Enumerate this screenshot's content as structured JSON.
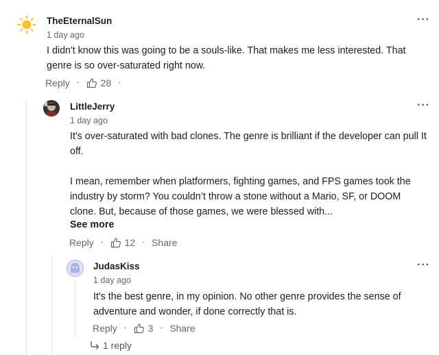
{
  "comments": [
    {
      "username": "TheEternalSun",
      "time": "1 day ago",
      "lines": [
        "I didn't know this was going to be a souls-like. That makes me less interested. That",
        "genre is so over-saturated right now."
      ],
      "actions": {
        "reply": "Reply",
        "likes": "28"
      },
      "avatar_icon": "sun-icon",
      "avatar_color": "#f6c12b"
    },
    {
      "username": "LittleJerry",
      "time": "1 day ago",
      "lines": [
        "It's over-saturated with bad clones. The genre is brilliant if the developer can pull It",
        "off.",
        "",
        "I mean, remember when platformers, fighting games, and FPS games took the",
        "industry by storm? You couldn’t throw a stone without a Mario, SF, or DOOM",
        "clone. But, because of those games, we were blessed with..."
      ],
      "see_more": "See more",
      "actions": {
        "reply": "Reply",
        "likes": "12",
        "share": "Share"
      },
      "avatar_icon": "photo-avatar-icon"
    },
    {
      "username": "JudasKiss",
      "time": "1 day ago",
      "lines": [
        "It's the best genre, in my opinion. No other genre provides the sense of",
        "adventure and wonder, if done correctly that is."
      ],
      "actions": {
        "reply": "Reply",
        "likes": "3",
        "share": "Share"
      },
      "replies_link": "1 reply",
      "avatar_icon": "ghost-avatar-icon",
      "avatar_color": "#a9b3e6"
    }
  ],
  "icons": {
    "more": "more-options-icon",
    "like": "thumbs-up-icon",
    "reply_arrow": "reply-arrow-icon"
  },
  "more_glyph": "···",
  "dot_glyph": "•"
}
